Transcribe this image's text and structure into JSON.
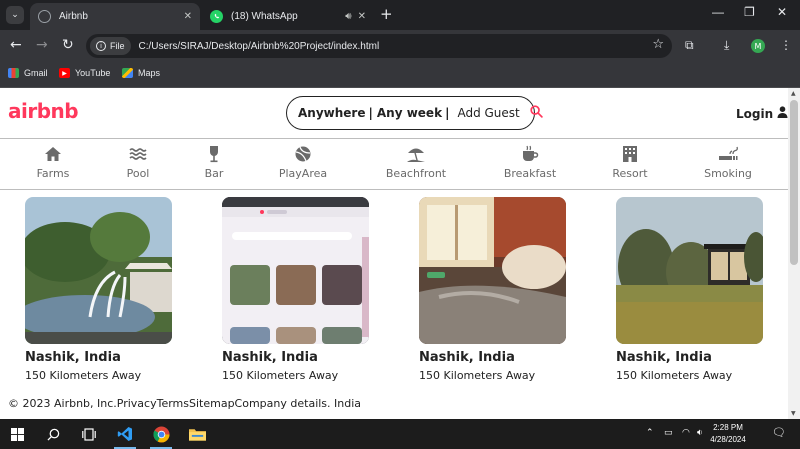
{
  "browser": {
    "tabs": [
      {
        "title": "Airbnb",
        "active": true,
        "icon": "globe-icon"
      },
      {
        "title": "(18) WhatsApp",
        "active": false,
        "icon": "whatsapp-icon"
      }
    ],
    "address": {
      "chip_label": "File",
      "url": "C:/Users/SIRAJ/Desktop/Airbnb%20Project/index.html"
    },
    "profile_initial": "M",
    "bookmarks": [
      {
        "label": "Gmail",
        "icon": "gmail-icon"
      },
      {
        "label": "YouTube",
        "icon": "youtube-icon"
      },
      {
        "label": "Maps",
        "icon": "maps-icon"
      }
    ]
  },
  "site": {
    "logo": "airbnb",
    "search": {
      "where": "Anywhere",
      "when": "Any week",
      "divider": "|",
      "guest": "Add Guest"
    },
    "login_label": "Login",
    "categories": [
      {
        "label": "Farms",
        "icon": "farm-icon"
      },
      {
        "label": "Pool",
        "icon": "pool-icon"
      },
      {
        "label": "Bar",
        "icon": "bar-icon"
      },
      {
        "label": "PlayArea",
        "icon": "play-area-icon"
      },
      {
        "label": "Beachfront",
        "icon": "beachfront-icon"
      },
      {
        "label": "Breakfast",
        "icon": "breakfast-icon"
      },
      {
        "label": "Resort",
        "icon": "resort-icon"
      },
      {
        "label": "Smoking",
        "icon": "smoking-icon"
      }
    ],
    "listings": [
      {
        "location": "Nashik, India",
        "distance": "150 Kilometers Away",
        "photo": "fountain-villa-photo"
      },
      {
        "location": "Nashik, India",
        "distance": "150 Kilometers Away",
        "photo": "laptop-screenshot-photo"
      },
      {
        "location": "Nashik, India",
        "distance": "150 Kilometers Away",
        "photo": "cozy-bed-window-photo"
      },
      {
        "location": "Nashik, India",
        "distance": "150 Kilometers Away",
        "photo": "glass-cabin-photo"
      }
    ],
    "footer": "© 2023 Airbnb, Inc.PrivacyTermsSitemapCompany details. India"
  },
  "taskbar": {
    "time": "2:28 PM",
    "date": "4/28/2024"
  },
  "colors": {
    "brand": "#ff385c",
    "chrome_dark": "#202124",
    "chrome_mid": "#35363a",
    "taskbar": "#1c1c1c"
  }
}
